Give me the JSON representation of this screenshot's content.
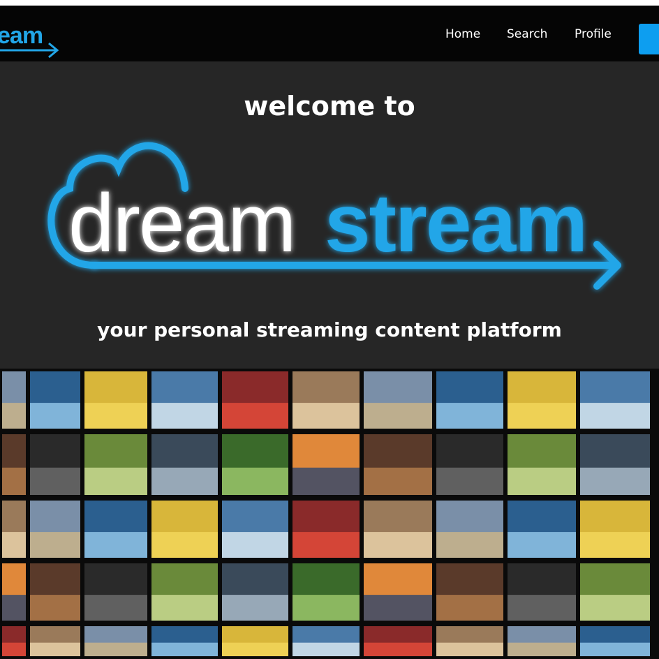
{
  "nav": {
    "logo_text": "eam",
    "links": [
      {
        "label": "Home"
      },
      {
        "label": "Search"
      },
      {
        "label": "Profile"
      }
    ]
  },
  "hero": {
    "welcome": "welcome to",
    "logo_part1": "dream",
    "logo_part2": "stream",
    "tagline": "your personal streaming content platform"
  },
  "colors": {
    "accent": "#22a6e8",
    "nav_bg": "#050505",
    "hero_bg": "#262626",
    "button": "#0d9ef0"
  },
  "icons": [
    "arrow-icon",
    "cloud-icon"
  ]
}
